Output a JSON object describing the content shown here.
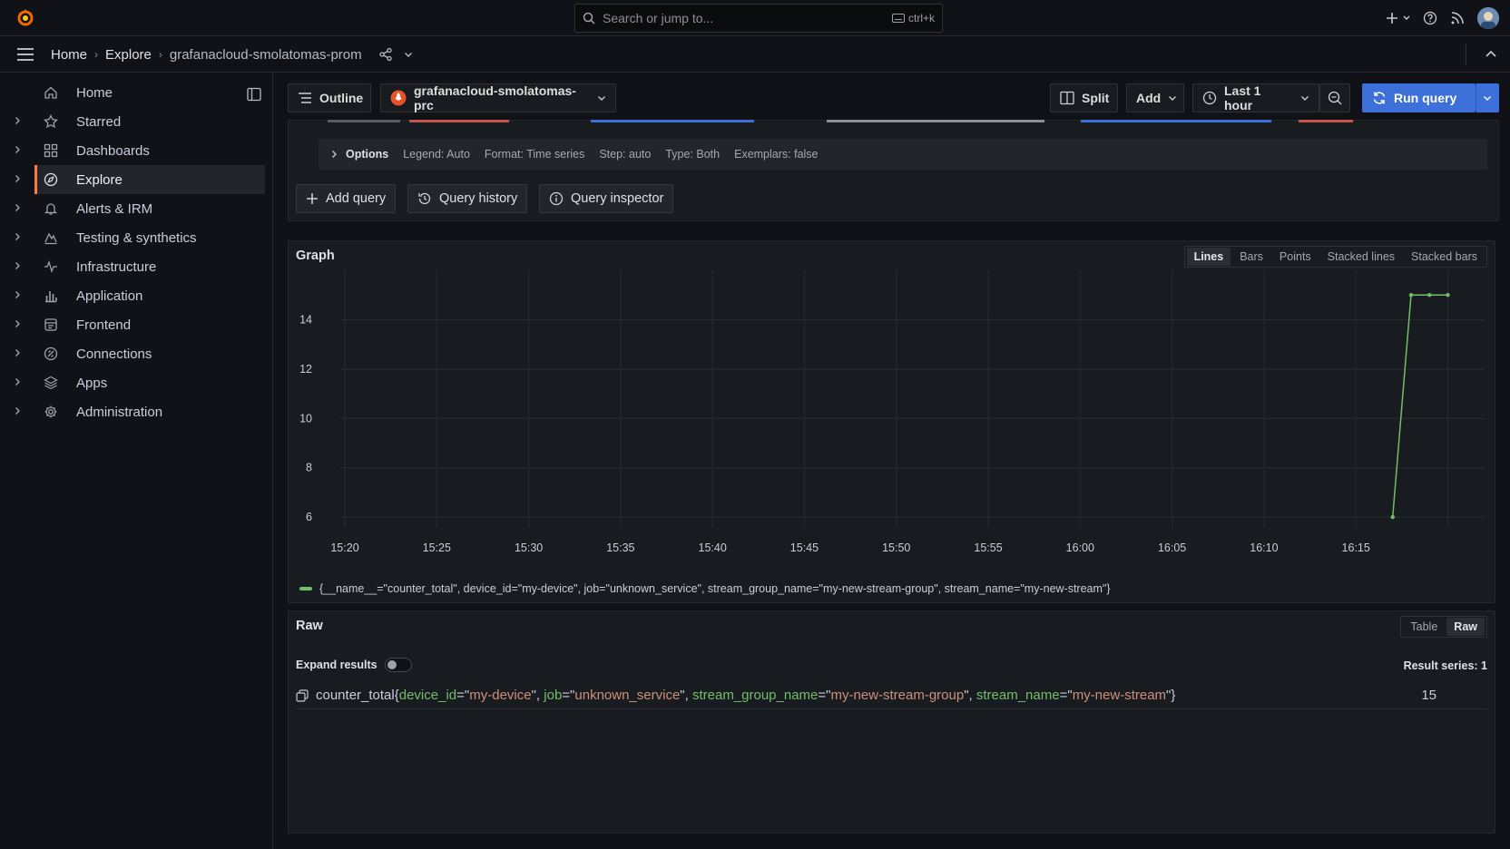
{
  "topbar": {
    "search_placeholder": "Search or jump to...",
    "search_shortcut": "ctrl+k"
  },
  "breadcrumbs": [
    "Home",
    "Explore",
    "grafanacloud-smolatomas-prom"
  ],
  "sidebar": {
    "items": [
      {
        "label": "Home",
        "icon": "home-icon",
        "expandable": false
      },
      {
        "label": "Starred",
        "icon": "star-icon",
        "expandable": true
      },
      {
        "label": "Dashboards",
        "icon": "dashboards-icon",
        "expandable": true
      },
      {
        "label": "Explore",
        "icon": "compass-icon",
        "expandable": true,
        "active": true
      },
      {
        "label": "Alerts & IRM",
        "icon": "bell-icon",
        "expandable": true
      },
      {
        "label": "Testing & synthetics",
        "icon": "synthetics-icon",
        "expandable": true
      },
      {
        "label": "Infrastructure",
        "icon": "heartbeat-icon",
        "expandable": true
      },
      {
        "label": "Application",
        "icon": "bar-chart-icon",
        "expandable": true
      },
      {
        "label": "Frontend",
        "icon": "frontend-icon",
        "expandable": true
      },
      {
        "label": "Connections",
        "icon": "connections-icon",
        "expandable": true
      },
      {
        "label": "Apps",
        "icon": "layers-icon",
        "expandable": true
      },
      {
        "label": "Administration",
        "icon": "cog-icon",
        "expandable": true
      }
    ]
  },
  "toolbar": {
    "outline": "Outline",
    "datasource": "grafanacloud-smolatomas-prc",
    "split": "Split",
    "add": "Add",
    "time_range": "Last 1 hour",
    "run_query": "Run query"
  },
  "query_options": {
    "label": "Options",
    "legend": "Legend: Auto",
    "format": "Format: Time series",
    "step": "Step: auto",
    "type": "Type: Both",
    "exemplars": "Exemplars: false"
  },
  "query_actions": {
    "add_query": "Add query",
    "query_history": "Query history",
    "query_inspector": "Query inspector"
  },
  "graph": {
    "title": "Graph",
    "modes": [
      "Lines",
      "Bars",
      "Points",
      "Stacked lines",
      "Stacked bars"
    ],
    "selected_mode": "Lines",
    "legend": "{__name__=\"counter_total\", device_id=\"my-device\", job=\"unknown_service\", stream_group_name=\"my-new-stream-group\", stream_name=\"my-new-stream\"}",
    "color": "#73bf69"
  },
  "chart_data": {
    "type": "line",
    "x_ticks": [
      "15:20",
      "15:25",
      "15:30",
      "15:35",
      "15:40",
      "15:45",
      "15:50",
      "15:55",
      "16:00",
      "16:05",
      "16:10",
      "16:15"
    ],
    "y_ticks": [
      6,
      8,
      10,
      12,
      14
    ],
    "x_range_min": [
      18.0,
      77.0
    ],
    "ylim": [
      5.6,
      16.0
    ],
    "series": [
      {
        "name": "{__name__=\"counter_total\", device_id=\"my-device\", job=\"unknown_service\", stream_group_name=\"my-new-stream-group\", stream_name=\"my-new-stream\"}",
        "points": [
          [
            75.0,
            6
          ],
          [
            76.0,
            15
          ],
          [
            77.0,
            15
          ],
          [
            78.0,
            15
          ]
        ]
      }
    ]
  },
  "raw": {
    "title": "Raw",
    "modes": [
      "Table",
      "Raw"
    ],
    "selected_mode": "Raw",
    "expand_label": "Expand results",
    "result_series": "Result series: 1",
    "metric": "counter_total",
    "labels": [
      {
        "key": "device_id",
        "value": "my-device"
      },
      {
        "key": "job",
        "value": "unknown_service"
      },
      {
        "key": "stream_group_name",
        "value": "my-new-stream-group"
      },
      {
        "key": "stream_name",
        "value": "my-new-stream"
      }
    ],
    "value": "15"
  }
}
